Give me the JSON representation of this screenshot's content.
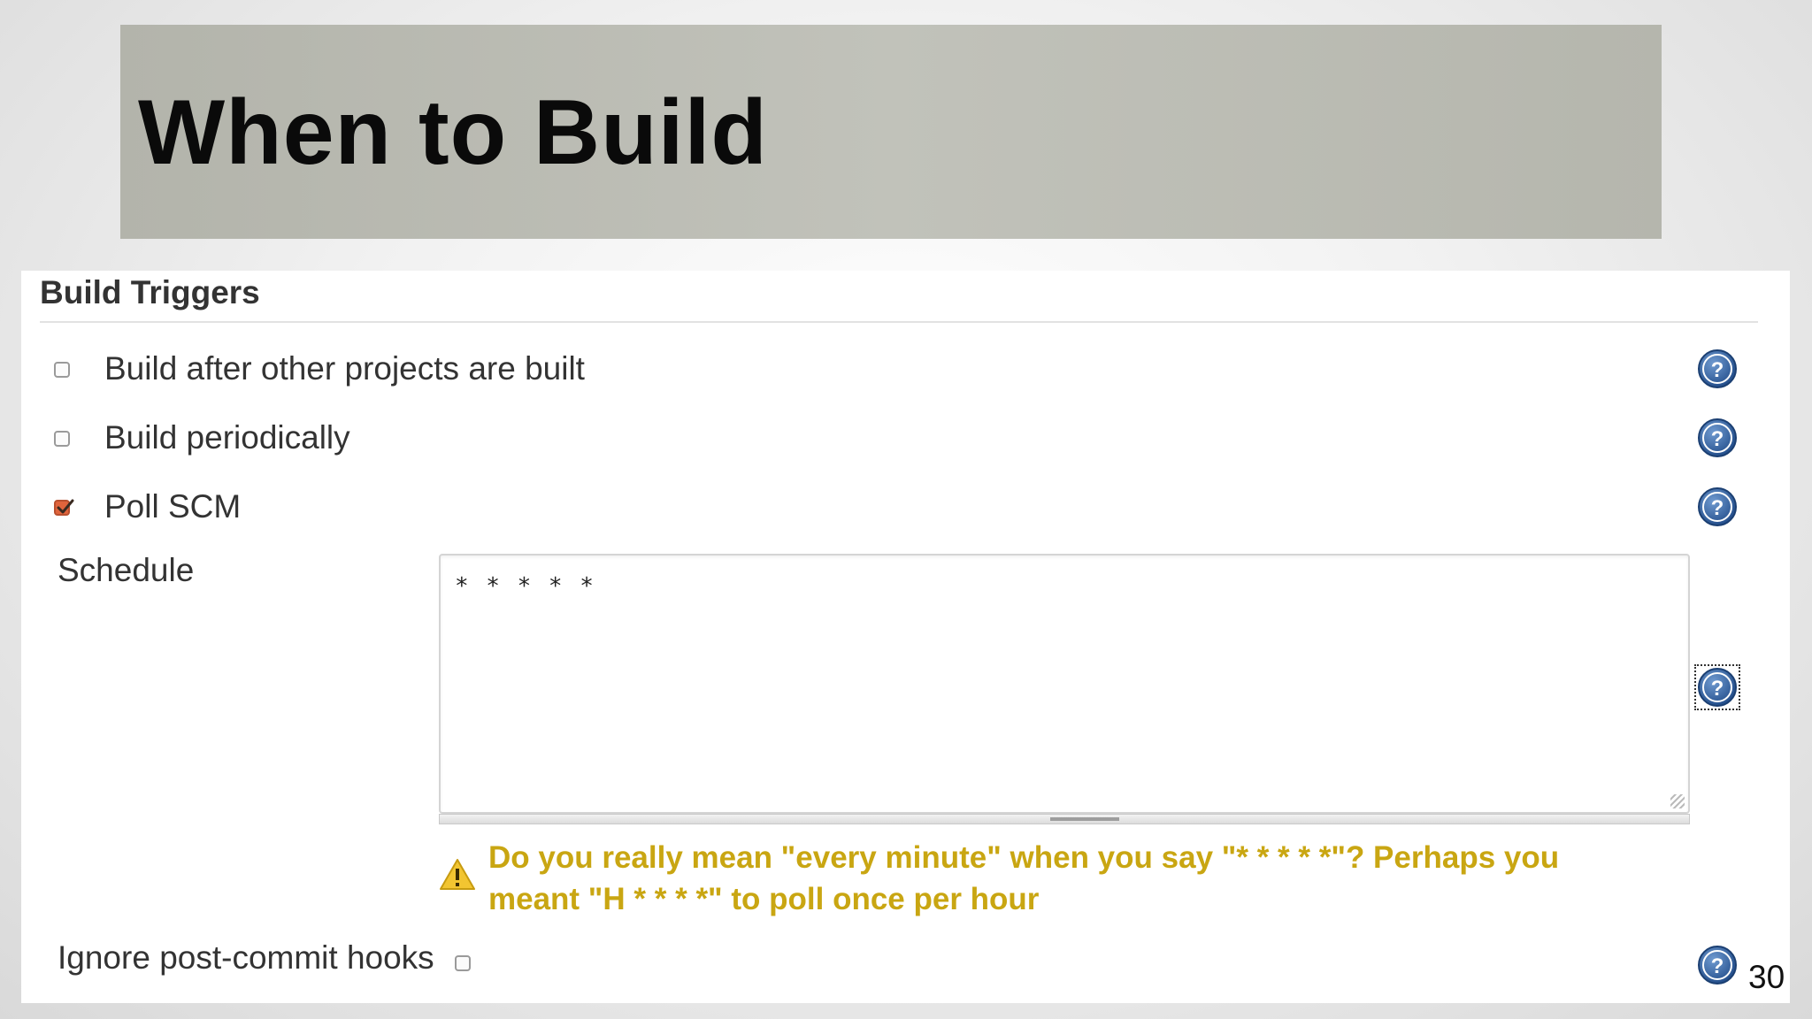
{
  "slide": {
    "title": "When to Build",
    "page_number": "30"
  },
  "build_triggers": {
    "section_title": "Build Triggers",
    "options": [
      {
        "label": "Build after other projects are built",
        "checked": false
      },
      {
        "label": "Build periodically",
        "checked": false
      },
      {
        "label": "Poll SCM",
        "checked": true
      }
    ],
    "schedule": {
      "label": "Schedule",
      "value": "* * * * *",
      "warning": "Do you really mean \"every minute\" when you say \"* * * * *\"? Perhaps you meant \"H * * * *\" to poll once per hour"
    },
    "ignore_hooks": {
      "label": "Ignore post-commit hooks",
      "checked": false
    }
  },
  "icons": {
    "help": "help-icon",
    "warning": "warning-icon",
    "check": "checkmark-icon"
  },
  "colors": {
    "checkbox_checked": "#e0643c",
    "help_blue": "#2f5e9a",
    "warning_text": "#c9a612",
    "title_bar": "#bbbcb3"
  }
}
